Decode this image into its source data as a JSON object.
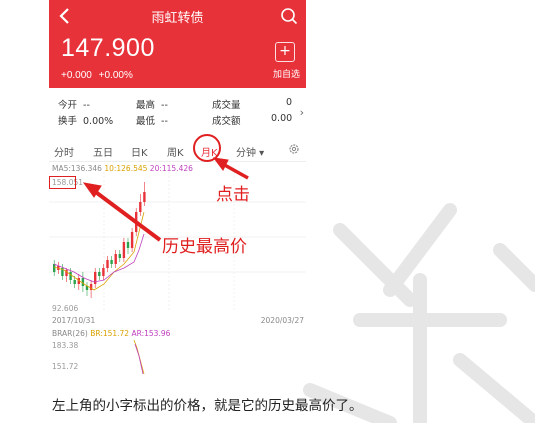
{
  "colors": {
    "brand": "#e8323a",
    "annotation": "#e02020",
    "up": "#e8323a",
    "down": "#2aa14a"
  },
  "header": {
    "title": "雨虹转债",
    "price": "147.900",
    "change_abs": "+0.000",
    "change_pct": "+0.00%",
    "add_icon": "+",
    "add_label": "加自选"
  },
  "stats": {
    "open_label": "今开",
    "open_value": "--",
    "high_label": "最高",
    "high_value": "--",
    "volume_label": "成交量",
    "volume_value": "0",
    "turnover_label": "换手",
    "turnover_value": "0.00%",
    "low_label": "最低",
    "low_value": "--",
    "amount_label": "成交额",
    "amount_value": "0.00",
    "more_icon": "›"
  },
  "tabs": [
    {
      "label": "分时"
    },
    {
      "label": "五日"
    },
    {
      "label": "日K"
    },
    {
      "label": "周K"
    },
    {
      "label": "月K"
    },
    {
      "label": "分钟 ▾"
    }
  ],
  "chart": {
    "ma_label": "MA5:136.346",
    "ma10": "10:126.545",
    "ma20": "20:115.426",
    "high_value": "158.051",
    "low_value": "92.606",
    "start_date": "2017/10/31",
    "end_date": "2020/03/27"
  },
  "brar": {
    "label": "BRAR(26)",
    "br": "BR:151.72",
    "ar": "AR:153.96",
    "v1": "183.38",
    "v2": "151.72"
  },
  "annotations": {
    "click": "点击",
    "high": "历史最高价"
  },
  "caption": "左上角的小字标出的价格，就是它的历史最高价了。"
}
